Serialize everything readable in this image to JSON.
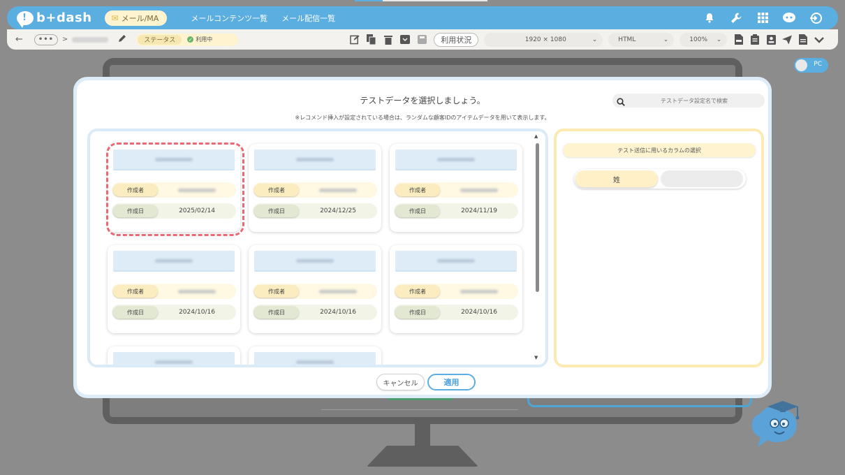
{
  "app": {
    "logo": "b+dash",
    "mode": "メール/MA",
    "nav": [
      "メールコンテンツ一覧",
      "メール配信一覧"
    ]
  },
  "toolbar": {
    "status_label": "ステータス",
    "status_value": "利用中",
    "usage_button": "利用状況",
    "resolution": "1920 × 1080",
    "format": "HTML",
    "zoom": "100%"
  },
  "preview_toggle": "PC",
  "modal": {
    "title": "テストデータを選択しましょう。",
    "search_placeholder": "テストデータ設定名で検索",
    "note": "※レコメンド挿入が設定されている場合は、ランダムな顧客IDのアイテムデータを用いて表示します。",
    "cards": [
      {
        "author_label": "作成者",
        "date_label": "作成日",
        "date": "2025/02/14"
      },
      {
        "author_label": "作成者",
        "date_label": "作成日",
        "date": "2024/12/25"
      },
      {
        "author_label": "作成者",
        "date_label": "作成日",
        "date": "2024/11/19"
      },
      {
        "author_label": "作成者",
        "date_label": "作成日",
        "date": "2024/10/16"
      },
      {
        "author_label": "作成者",
        "date_label": "作成日",
        "date": "2024/10/16"
      },
      {
        "author_label": "作成者",
        "date_label": "作成日",
        "date": "2024/10/16"
      }
    ],
    "column_panel": {
      "header": "テスト送信に用いるカラムの選択",
      "selected_chip": "姓"
    },
    "cancel_label": "キャンセル",
    "apply_label": "適用"
  },
  "colors": {
    "brand_blue": "#5aaee0",
    "selected_dash": "#e96a75",
    "panel_yellow": "#fde9b2"
  }
}
